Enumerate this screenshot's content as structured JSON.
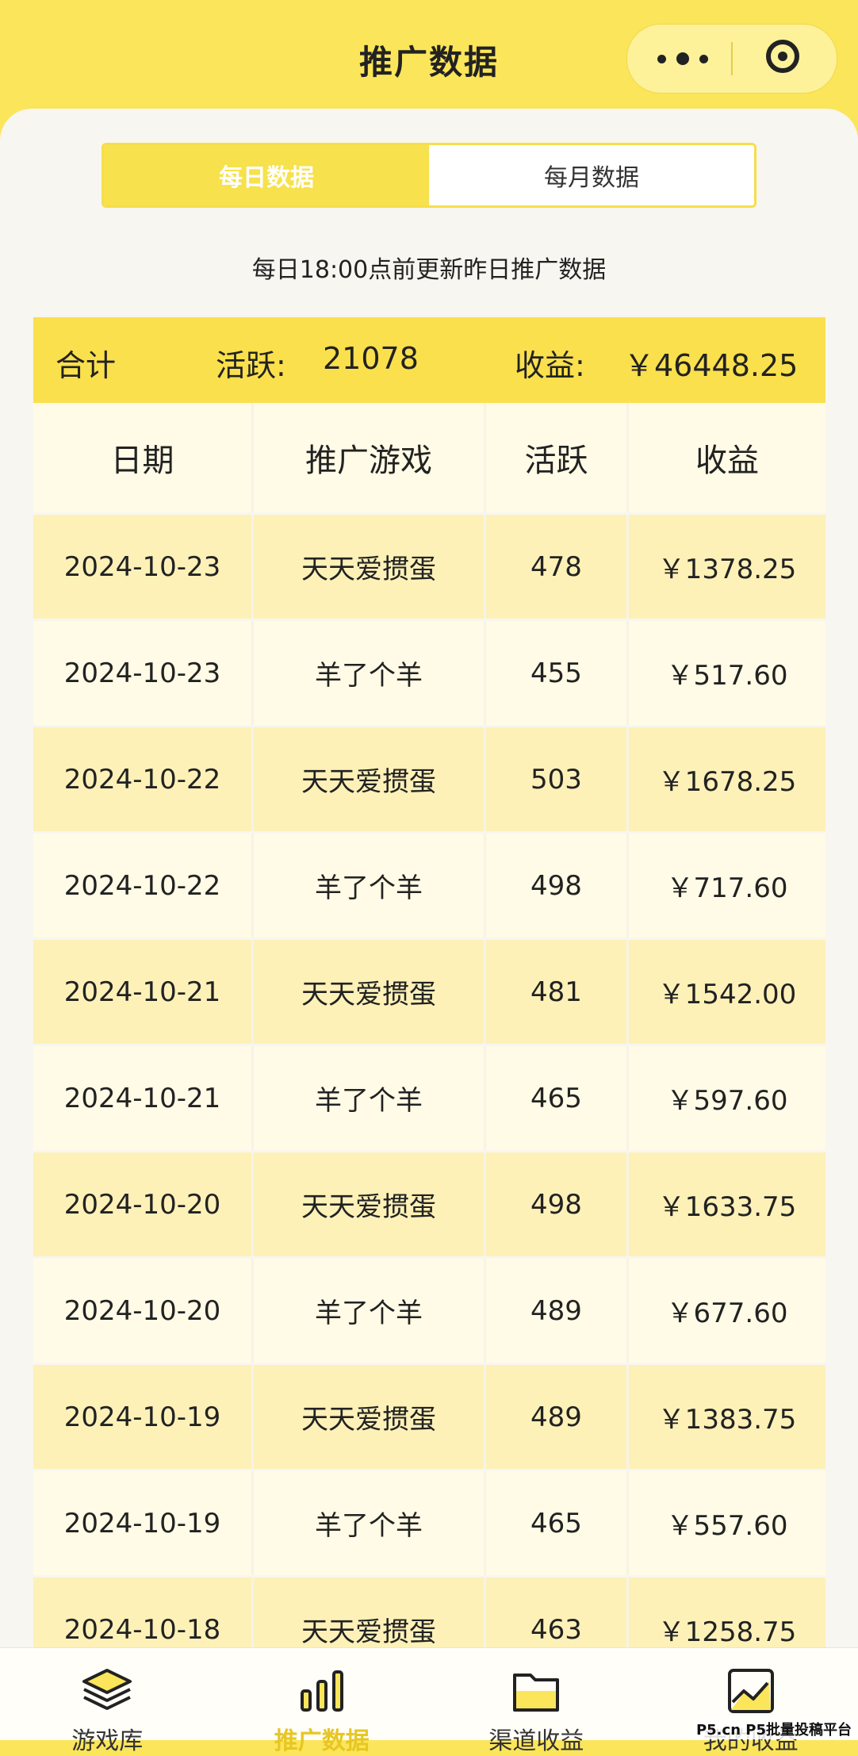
{
  "header": {
    "title": "推广数据"
  },
  "tabs": [
    {
      "label": "每日数据",
      "active": true
    },
    {
      "label": "每月数据",
      "active": false
    }
  ],
  "update_note": "每日18:00点前更新昨日推广数据",
  "summary": {
    "total_label": "合计",
    "active_label": "活跃:",
    "active_value": "21078",
    "income_label": "收益:",
    "income_value": "￥46448.25"
  },
  "table": {
    "headers": [
      "日期",
      "推广游戏",
      "活跃",
      "收益"
    ],
    "rows": [
      [
        "2024-10-23",
        "天天爱掼蛋",
        "478",
        "￥1378.25"
      ],
      [
        "2024-10-23",
        "羊了个羊",
        "455",
        "￥517.60"
      ],
      [
        "2024-10-22",
        "天天爱掼蛋",
        "503",
        "￥1678.25"
      ],
      [
        "2024-10-22",
        "羊了个羊",
        "498",
        "￥717.60"
      ],
      [
        "2024-10-21",
        "天天爱掼蛋",
        "481",
        "￥1542.00"
      ],
      [
        "2024-10-21",
        "羊了个羊",
        "465",
        "￥597.60"
      ],
      [
        "2024-10-20",
        "天天爱掼蛋",
        "498",
        "￥1633.75"
      ],
      [
        "2024-10-20",
        "羊了个羊",
        "489",
        "￥677.60"
      ],
      [
        "2024-10-19",
        "天天爱掼蛋",
        "489",
        "￥1383.75"
      ],
      [
        "2024-10-19",
        "羊了个羊",
        "465",
        "￥557.60"
      ],
      [
        "2024-10-18",
        "天天爱掼蛋",
        "463",
        "￥1258.75"
      ]
    ]
  },
  "tabbar": [
    {
      "label": "游戏库",
      "icon": "layers-icon",
      "active": false
    },
    {
      "label": "推广数据",
      "icon": "bar-chart-icon",
      "active": true
    },
    {
      "label": "渠道收益",
      "icon": "folder-icon",
      "active": false
    },
    {
      "label": "我的收益",
      "icon": "trend-chart-icon",
      "active": false
    }
  ],
  "watermark": "P5.cn P5批量投稿平台",
  "colors": {
    "brand_yellow": "#fbe55a",
    "row_alt": "#fdf1b8",
    "row_base": "#fffbe6"
  }
}
